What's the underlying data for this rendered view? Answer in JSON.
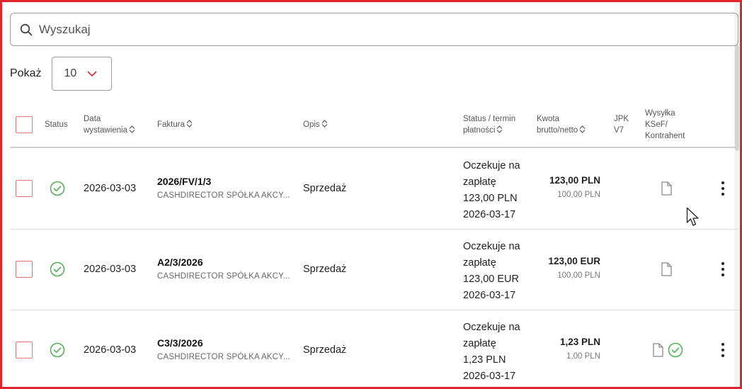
{
  "search": {
    "placeholder": "Wyszukaj"
  },
  "page_size": {
    "label": "Pokaż",
    "value": "10"
  },
  "columns": {
    "status": "Status",
    "date_l1": "Data",
    "date_l2": "wystawienia",
    "invoice": "Faktura",
    "desc": "Opis",
    "payment_l1": "Status / termin",
    "payment_l2": "płatności",
    "amount_l1": "Kwota",
    "amount_l2": "brutto/netto",
    "jpk_l1": "JPK",
    "jpk_l2": "V7",
    "ksef_l1": "Wysyłka",
    "ksef_l2": "KSeF/",
    "ksef_l3": "Kontrahent"
  },
  "rows": [
    {
      "date": "2026-03-03",
      "invoice_number": "2026/FV/1/3",
      "client": "CASHDIRECTOR SPÓŁKA AKCY...",
      "description": "Sprzedaż",
      "status_l1": "Oczekuje na",
      "status_l2": "zapłatę",
      "status_amount": "123,00 PLN",
      "due_date": "2026-03-17",
      "gross": "123,00 PLN",
      "net": "100,00 PLN",
      "ksef_sent": false
    },
    {
      "date": "2026-03-03",
      "invoice_number": "A2/3/2026",
      "client": "CASHDIRECTOR SPÓŁKA AKCY...",
      "description": "Sprzedaż",
      "status_l1": "Oczekuje na",
      "status_l2": "zapłatę",
      "status_amount": "123,00 EUR",
      "due_date": "2026-03-17",
      "gross": "123,00 EUR",
      "net": "100,00 PLN",
      "ksef_sent": false
    },
    {
      "date": "2026-03-03",
      "invoice_number": "C3/3/2026",
      "client": "CASHDIRECTOR SPÓŁKA AKCY...",
      "description": "Sprzedaż",
      "status_l1": "Oczekuje na",
      "status_l2": "zapłatę",
      "status_amount": "1,23 PLN",
      "due_date": "2026-03-17",
      "gross": "1,23 PLN",
      "net": "1,00 PLN",
      "ksef_sent": true
    }
  ],
  "colors": {
    "accent": "#e0242b",
    "checkbox_border": "#e57373",
    "success": "#4caf50"
  },
  "icons": [
    "search-icon",
    "chevron-down-icon",
    "sort-icon",
    "status-ok-icon",
    "document-icon",
    "ksef-ok-icon",
    "more-vert-icon",
    "cursor-icon"
  ]
}
